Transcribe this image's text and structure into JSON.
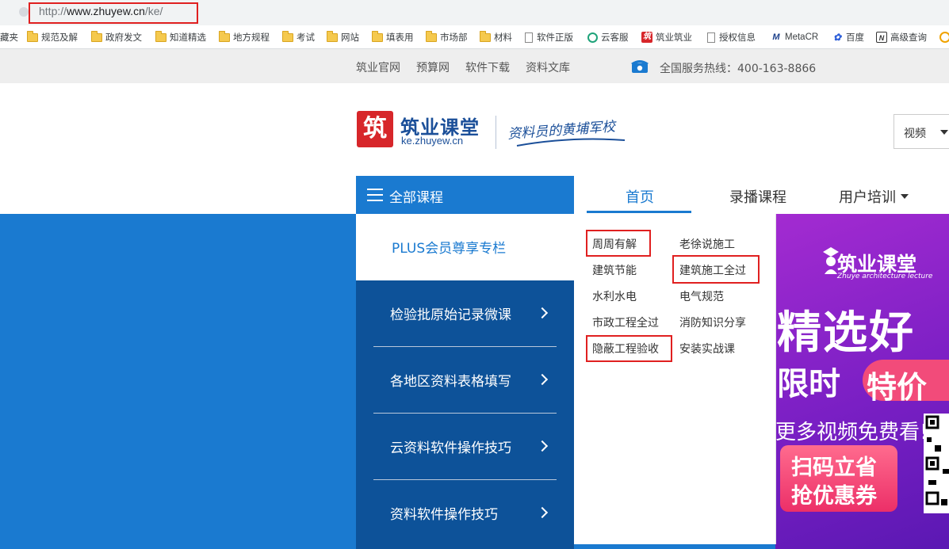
{
  "browser": {
    "url_prefix": "http://",
    "url_host": "www.zhuyew.cn",
    "url_path": "/ke/"
  },
  "bookmarks": [
    {
      "label": "藏夹",
      "icon": "none"
    },
    {
      "label": "规范及解",
      "icon": "folder-icon"
    },
    {
      "label": "政府发文",
      "icon": "folder-icon"
    },
    {
      "label": "知道精选",
      "icon": "folder-icon"
    },
    {
      "label": "地方规程",
      "icon": "folder-icon"
    },
    {
      "label": "考试",
      "icon": "folder-icon"
    },
    {
      "label": "网站",
      "icon": "folder-icon"
    },
    {
      "label": "填表用",
      "icon": "folder-icon"
    },
    {
      "label": "市场部",
      "icon": "folder-icon"
    },
    {
      "label": "材料",
      "icon": "folder-icon"
    },
    {
      "label": "软件正版",
      "icon": "page-icon"
    },
    {
      "label": "云客服",
      "icon": "cloud-service-icon"
    },
    {
      "label": "筑业筑业",
      "icon": "zhuye-icon"
    },
    {
      "label": "授权信息",
      "icon": "page-icon"
    },
    {
      "label": "MetaCR",
      "icon": "metacr-icon"
    },
    {
      "label": "百度",
      "icon": "baidu-icon"
    },
    {
      "label": "高级查询",
      "icon": "query-icon"
    }
  ],
  "topnav": {
    "links": [
      "筑业官网",
      "预算网",
      "软件下载",
      "资料文库"
    ],
    "hotline": "全国服务热线：400-163-8866"
  },
  "logo": {
    "mark": "筑",
    "title": "筑业课堂",
    "domain": "ke.zhuyew.cn",
    "slogan": "资料员的黄埔军校"
  },
  "search": {
    "select_value": "视频"
  },
  "category": {
    "header": "全部课程",
    "plus": "PLUS会员尊享专栏",
    "items": [
      "检验批原始记录微课",
      "各地区资料表格填写",
      "云资料软件操作技巧",
      "资料软件操作技巧"
    ]
  },
  "tabs": [
    "首页",
    "录播课程",
    "用户培训"
  ],
  "submenu": {
    "col1": [
      "周周有解",
      "建筑节能",
      "水利水电",
      "市政工程全过",
      "隐蔽工程验收"
    ],
    "col2": [
      "老徐说施工",
      "建筑施工全过",
      "电气规范",
      "消防知识分享",
      "安装实战课"
    ]
  },
  "ad": {
    "brand": "筑业课堂",
    "brand_sub": "Zhuye architecture lecture",
    "headline1": "精选好",
    "headline2a": "限时",
    "headline2b": "特价",
    "free_text": "更多视频免费看!",
    "btn_line1": "扫码立省",
    "btn_line2": "抢优惠券"
  },
  "colors": {
    "brand_blue": "#1a7ad0",
    "nav_dark_blue": "#0d5299",
    "logo_red": "#d7262a",
    "highlight_red": "#e02020"
  }
}
